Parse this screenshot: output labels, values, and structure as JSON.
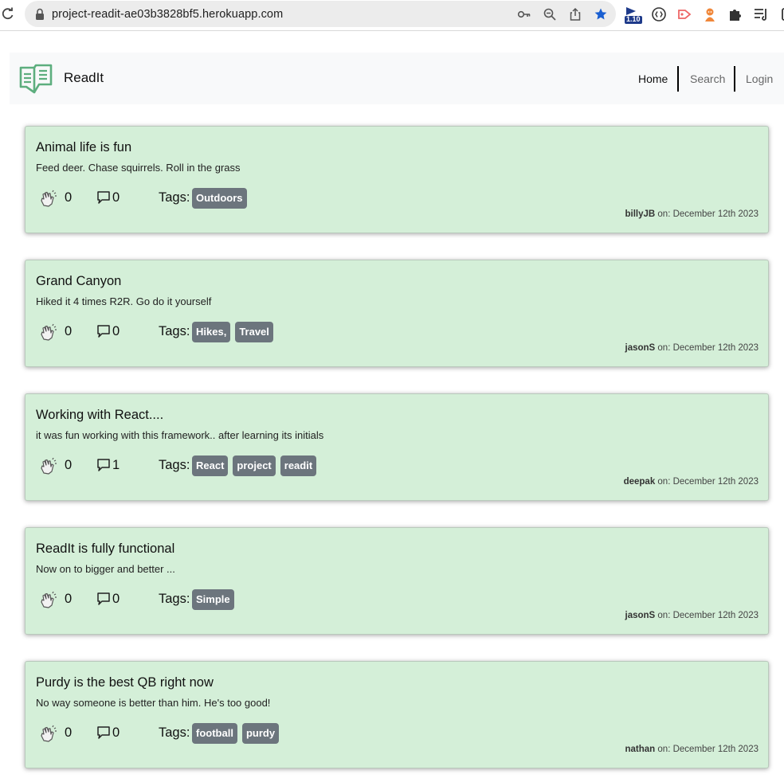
{
  "browser": {
    "url": "project-readit-ae03b3828bf5.herokuapp.com",
    "extension_badge": "1.10"
  },
  "navbar": {
    "brand": "ReadIt",
    "links": [
      {
        "label": "Home"
      },
      {
        "label": "Search"
      },
      {
        "label": "Login"
      }
    ]
  },
  "posts": [
    {
      "title": "Animal life is fun",
      "body": "Feed deer. Chase squirrels. Roll in the grass",
      "claps": "0",
      "comments": "0",
      "tags_label": "Tags:",
      "tags": [
        "Outdoors"
      ],
      "author": "billyJB",
      "date_text": " on: December 12th 2023"
    },
    {
      "title": "Grand Canyon",
      "body": "Hiked it 4 times R2R. Go do it yourself",
      "claps": "0",
      "comments": "0",
      "tags_label": "Tags:",
      "tags": [
        "Hikes,",
        "Travel"
      ],
      "author": "jasonS",
      "date_text": " on: December 12th 2023"
    },
    {
      "title": "Working with React....",
      "body": "it was fun working with this framework.. after learning its initials",
      "claps": "0",
      "comments": "1",
      "tags_label": "Tags:",
      "tags": [
        "React",
        "project",
        "readit"
      ],
      "author": "deepak",
      "date_text": " on: December 12th 2023"
    },
    {
      "title": "ReadIt is fully functional",
      "body": "Now on to bigger and better ...",
      "claps": "0",
      "comments": "0",
      "tags_label": "Tags:",
      "tags": [
        "Simple"
      ],
      "author": "jasonS",
      "date_text": " on: December 12th 2023"
    },
    {
      "title": "Purdy is the best QB right now",
      "body": "No way someone is better than him. He's too good!",
      "claps": "0",
      "comments": "0",
      "tags_label": "Tags:",
      "tags": [
        "football",
        "purdy"
      ],
      "author": "nathan",
      "date_text": " on: December 12th 2023"
    }
  ],
  "colors": {
    "card_bg": "#d4efd8",
    "tag_bg": "#6c757d",
    "navbar_bg": "#f8f9fa",
    "logo": "#5dae7e"
  },
  "icons": {
    "clap": "clap-icon",
    "comment": "comment-icon",
    "logo": "book-logo-icon"
  }
}
